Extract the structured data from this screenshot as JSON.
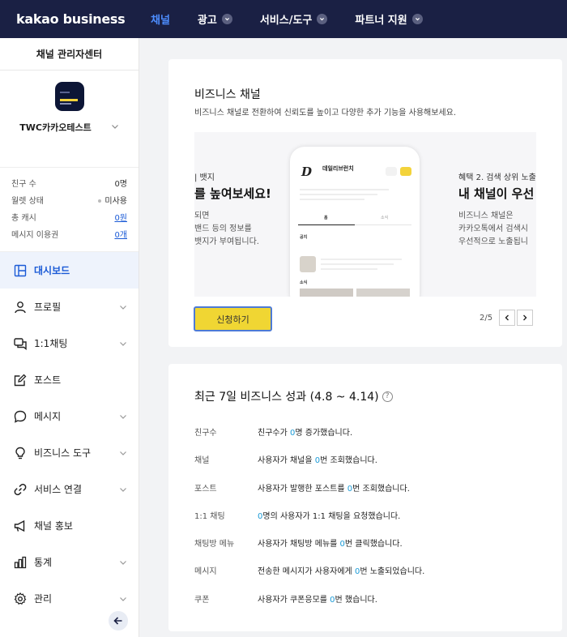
{
  "topbar": {
    "logo": "kakao business",
    "nav": [
      {
        "label": "채널",
        "active": true,
        "dropdown": false
      },
      {
        "label": "광고",
        "active": false,
        "dropdown": true
      },
      {
        "label": "서비스/도구",
        "active": false,
        "dropdown": true
      },
      {
        "label": "파트너 지원",
        "active": false,
        "dropdown": true
      }
    ]
  },
  "sidebar": {
    "title": "채널 관리자센터",
    "channel_name": "TWC카카오테스트",
    "stats": [
      {
        "label": "친구 수",
        "value": "0명"
      },
      {
        "label": "월렛 상태",
        "value": "미사용"
      },
      {
        "label": "총 캐시",
        "value": "0원"
      },
      {
        "label": "메시지 이용권",
        "value": "0개"
      }
    ],
    "menu": [
      {
        "label": "대시보드",
        "icon": "dashboard-icon"
      },
      {
        "label": "프로필",
        "icon": "person-icon"
      },
      {
        "label": "1:1채팅",
        "icon": "chat-icon"
      },
      {
        "label": "포스트",
        "icon": "edit-icon"
      },
      {
        "label": "메시지",
        "icon": "message-icon"
      },
      {
        "label": "비즈니스 도구",
        "icon": "lightbulb-icon"
      },
      {
        "label": "서비스 연결",
        "icon": "link-icon"
      },
      {
        "label": "채널 홍보",
        "icon": "megaphone-icon"
      },
      {
        "label": "통계",
        "icon": "bar-chart-icon"
      },
      {
        "label": "관리",
        "icon": "gear-icon"
      }
    ]
  },
  "business_channel": {
    "title": "비즈니스 채널",
    "description": "비즈니스 채널로 전환하여 신뢰도를 높이고 다양한 추가 기능을 사용해보세요.",
    "slide_left": {
      "line1": "| 뱃지",
      "headline": "를 높여보세요!",
      "line3": "되면",
      "line4": "밴드 등의 정보를",
      "line5": "뱃지가 부여됩니다."
    },
    "phone": {
      "logo": "D",
      "name": "데일리브런치",
      "tab_label": "홈",
      "tab2_label": "소식",
      "section1": "공지",
      "section2": "소식"
    },
    "slide_right": {
      "line1": "혜택 2. 검색 상위 노출",
      "headline": "내 채널이 우선",
      "line3": "비즈니스 채널은",
      "line4": "카카오톡에서 검색시",
      "line5": "우선적으로 노출됩니"
    },
    "apply_label": "신청하기",
    "page_indicator": "2/5"
  },
  "performance": {
    "title": "최근 7일 비즈니스 성과 (4.8 ~ 4.14)",
    "rows": [
      {
        "label": "친구수",
        "pre": "친구수가 ",
        "num": "0",
        "post": "명 증가했습니다."
      },
      {
        "label": "채널",
        "pre": "사용자가 채널을 ",
        "num": "0",
        "post": "번 조회했습니다."
      },
      {
        "label": "포스트",
        "pre": "사용자가 발행한 포스트를 ",
        "num": "0",
        "post": "번 조회했습니다."
      },
      {
        "label": "1:1 채팅",
        "pre": "",
        "num": "0",
        "post": "명의 사용자가 1:1 채팅을 요청했습니다."
      },
      {
        "label": "채팅방 메뉴",
        "pre": "사용자가 채팅방 메뉴를 ",
        "num": "0",
        "post": "번 클릭했습니다."
      },
      {
        "label": "메시지",
        "pre": "전송한 메시지가 사용자에게 ",
        "num": "0",
        "post": "번 노출되었습니다."
      },
      {
        "label": "쿠폰",
        "pre": "사용자가 쿠폰응모를 ",
        "num": "0",
        "post": "번 했습니다."
      }
    ]
  },
  "colors": {
    "topbar_bg": "#1a2044",
    "active_nav": "#4d8dff",
    "accent_blue": "#1a5ad6",
    "apply_yellow": "#f0d633",
    "number_blue": "#1a9ad6"
  }
}
